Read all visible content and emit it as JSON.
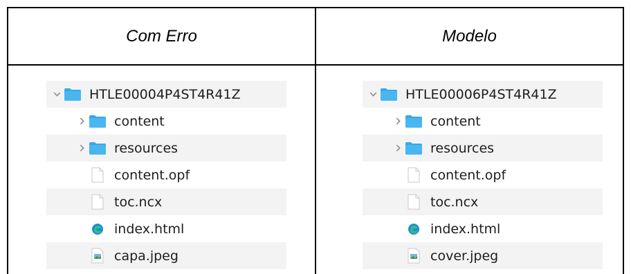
{
  "headers": {
    "left": "Com Erro",
    "right": "Modelo"
  },
  "left_tree": {
    "root": "HTLE00004P4ST4R41Z",
    "items": [
      "content",
      "resources",
      "content.opf",
      "toc.ncx",
      "index.html",
      "capa.jpeg"
    ]
  },
  "right_tree": {
    "root": "HTLE00006P4ST4R41Z",
    "items": [
      "content",
      "resources",
      "content.opf",
      "toc.ncx",
      "index.html",
      "cover.jpeg"
    ]
  },
  "icons": {
    "folder": "folder-icon",
    "file": "document-icon",
    "html": "browser-icon",
    "image": "image-icon",
    "chevron_open": "chevron-down-icon",
    "chevron_closed": "chevron-right-icon"
  },
  "colors": {
    "folder": "#35a9e8",
    "row_alt": "#f3f3f4",
    "chevron": "#8e8e93"
  }
}
